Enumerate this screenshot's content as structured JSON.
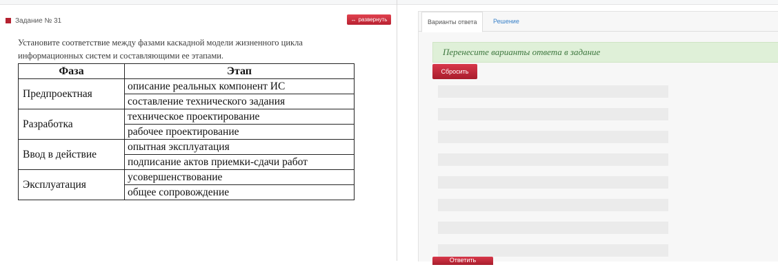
{
  "task": {
    "title": "Задание № 31",
    "expand_label": "развернуть",
    "expand_icon": "expand-arrows-icon",
    "question": "Установите соответствие между фазами каскадной модели жизненного цикла информационных систем и составляющими ее этапами.",
    "table": {
      "headers": [
        "Фаза",
        "Этап"
      ],
      "rows": [
        {
          "phase": "Предпроектная",
          "stages": [
            "описание реальных компонент ИС",
            "составление технического задания"
          ]
        },
        {
          "phase": "Разработка",
          "stages": [
            "техническое проектирование",
            "рабочее проектирование"
          ]
        },
        {
          "phase": "Ввод в действие",
          "stages": [
            "опытная эксплуатация",
            "подписание актов приемки-сдачи работ"
          ]
        },
        {
          "phase": "Эксплуатация",
          "stages": [
            "усовершенствование",
            "общее сопровождение"
          ]
        }
      ]
    }
  },
  "answer_panel": {
    "tabs": [
      "Варианты ответа",
      "Решение"
    ],
    "active_tab": "Варианты ответа",
    "hint": "Перенесите варианты ответа в задание",
    "reset_label": "Сбросить",
    "bottom_button_label": "Ответить"
  },
  "colors": {
    "accent_red": "#b82131",
    "hint_bg": "#dff0d8",
    "hint_text": "#3c763d",
    "link_blue": "#3a82c9"
  }
}
